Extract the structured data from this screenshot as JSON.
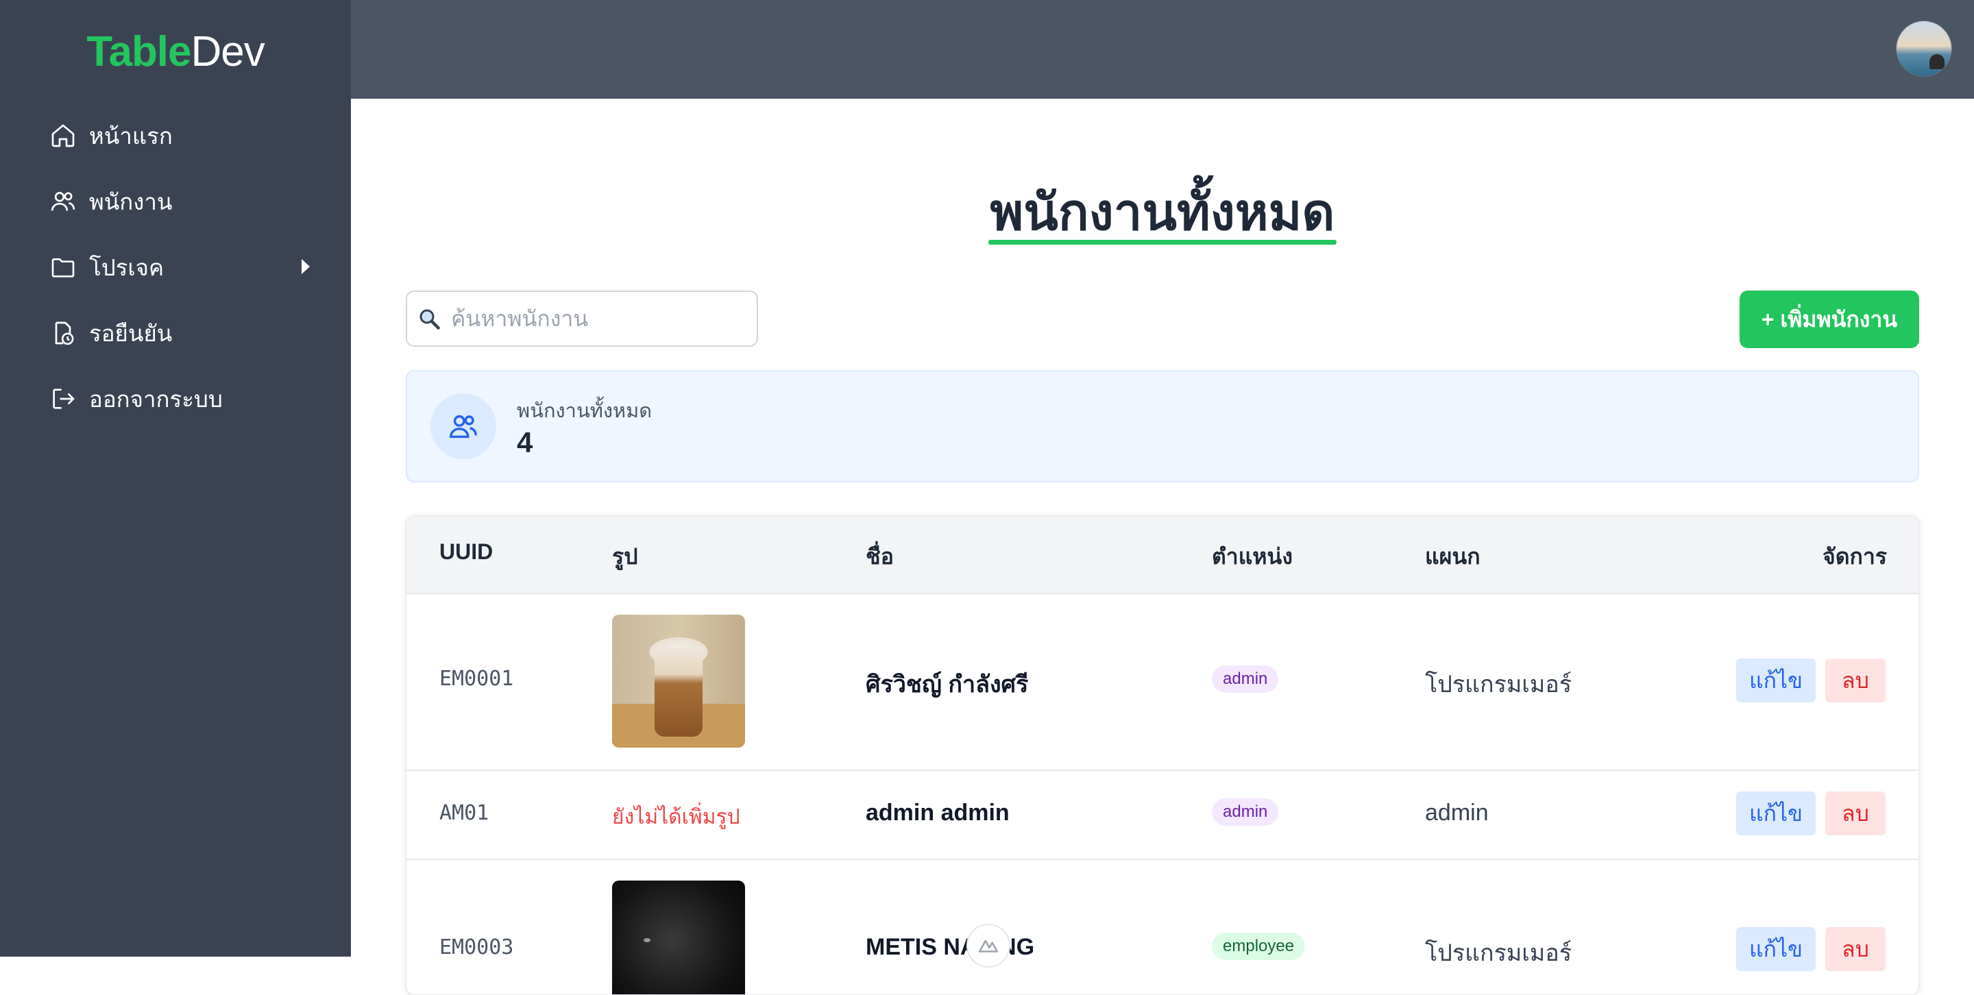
{
  "brand": {
    "part1": "Table",
    "part2": "Dev"
  },
  "sidebar": {
    "items": [
      {
        "label": "หน้าแรก",
        "icon": "home-icon"
      },
      {
        "label": "พนักงาน",
        "icon": "users-icon"
      },
      {
        "label": "โปรเจค",
        "icon": "folder-icon",
        "has_submenu": true
      },
      {
        "label": "รอยืนยัน",
        "icon": "pending-clock-icon"
      },
      {
        "label": "ออกจากระบบ",
        "icon": "logout-icon"
      }
    ]
  },
  "header": {
    "avatar_icon": "avatar"
  },
  "main": {
    "title": "พนักงานทั้งหมด",
    "search": {
      "placeholder": "ค้นหาพนักงาน",
      "value": ""
    },
    "add_button": "+ เพิ่มพนักงาน",
    "stat": {
      "label": "พนักงานทั้งหมด",
      "value": "4"
    }
  },
  "table": {
    "headers": [
      "UUID",
      "รูป",
      "ชื่อ",
      "ตำแหน่ง",
      "แผนก",
      "จัดการ"
    ],
    "rows": [
      {
        "uuid": "EM0001",
        "photo": "coffee-photo",
        "name": "ศิรวิชญ์ กำลังศรี",
        "role": "admin",
        "dept": "โปรแกรมเมอร์",
        "edit": "แก้ไข",
        "delete": "ลบ"
      },
      {
        "uuid": "AM01",
        "photo_text": "ยังไม่ได้เพิ่มรูป",
        "name": "admin admin",
        "role": "admin",
        "dept": "admin",
        "edit": "แก้ไข",
        "delete": "ลบ"
      },
      {
        "uuid": "EM0003",
        "photo": "cat-photo",
        "name": "METIS NA  UNG",
        "role": "employee",
        "dept": "โปรแกรมเมอร์",
        "edit": "แก้ไข",
        "delete": "ลบ"
      }
    ]
  },
  "colors": {
    "accent": "#22c55e",
    "sidebar": "#3b4352",
    "topbar": "#4b5563"
  }
}
